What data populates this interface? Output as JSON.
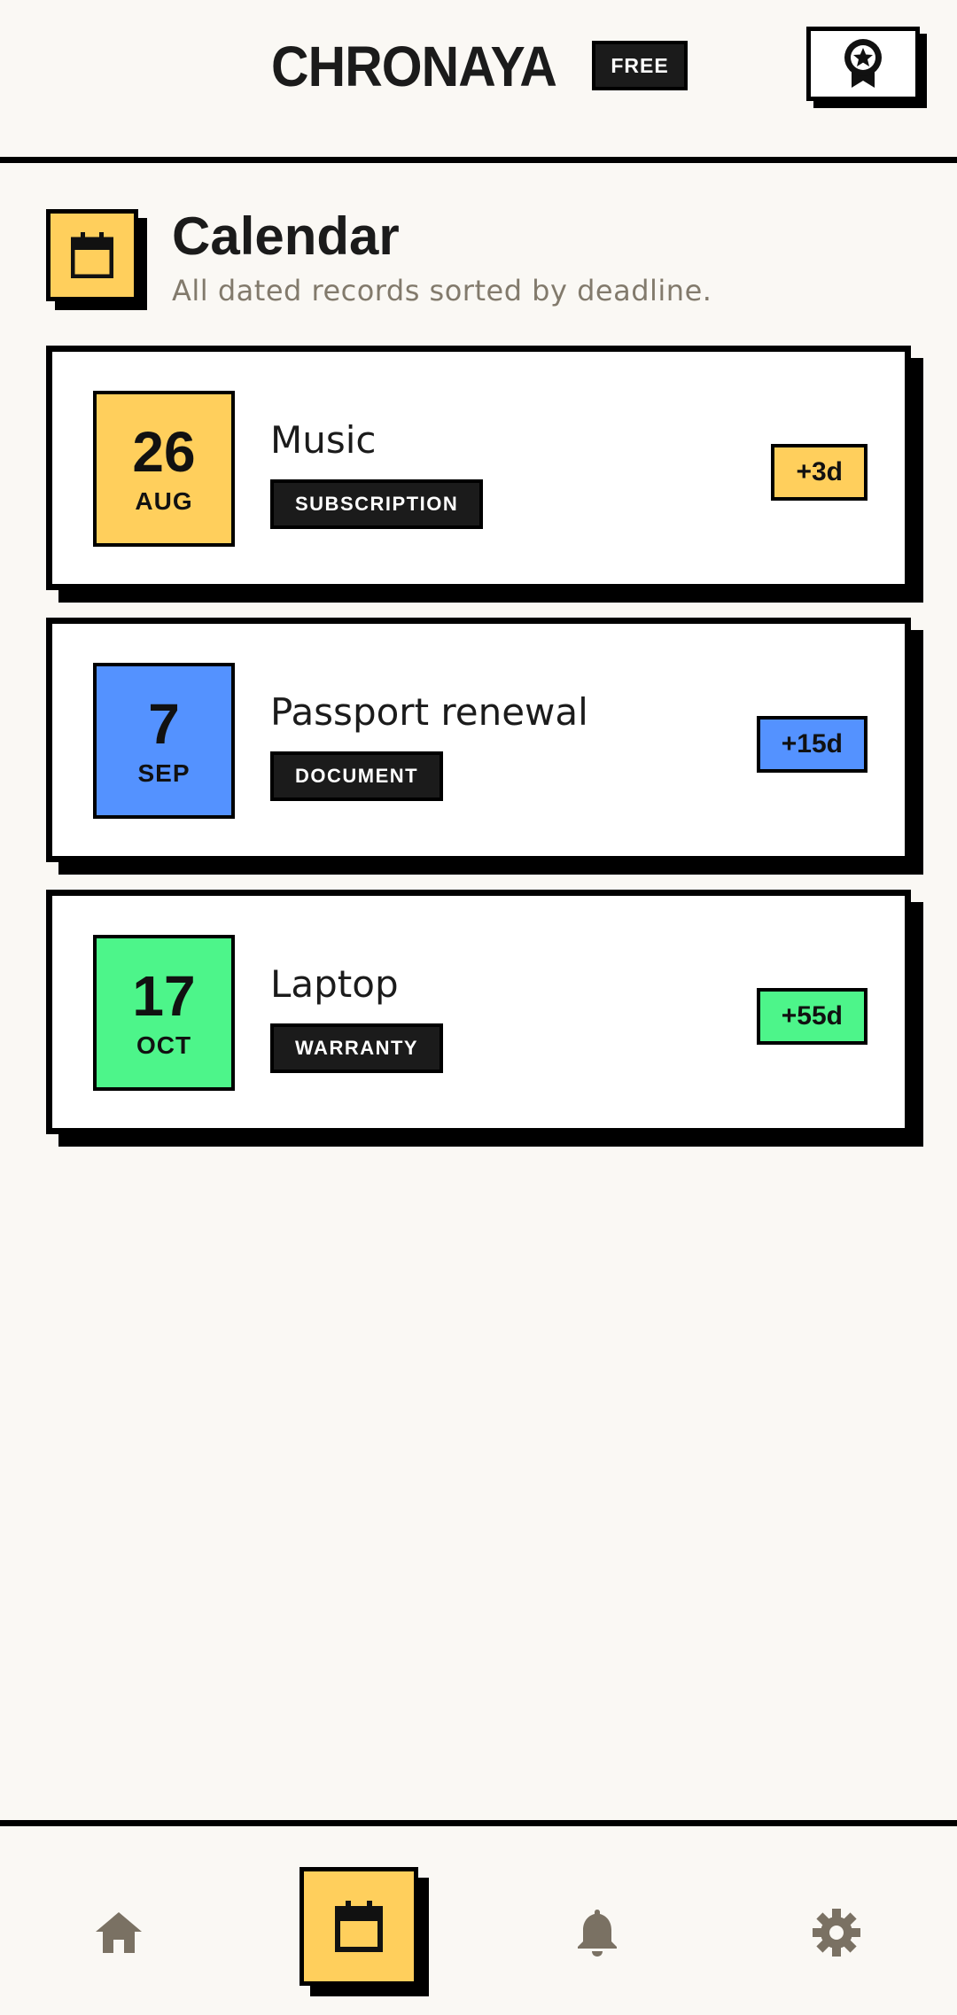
{
  "header": {
    "brand": "CHRONAYA",
    "plan_badge": "FREE",
    "award_icon": "award-ribbon-icon"
  },
  "page": {
    "icon": "calendar-icon",
    "title": "Calendar",
    "subtitle": "All dated records sorted by deadline."
  },
  "records": [
    {
      "day": "26",
      "month": "AUG",
      "name": "Music",
      "category": "SUBSCRIPTION",
      "days_left": "+3d",
      "color": "#ffcf5c"
    },
    {
      "day": "7",
      "month": "SEP",
      "name": "Passport renewal",
      "category": "DOCUMENT",
      "days_left": "+15d",
      "color": "#5492ff"
    },
    {
      "day": "17",
      "month": "OCT",
      "name": "Laptop",
      "category": "WARRANTY",
      "days_left": "+55d",
      "color": "#4df58a"
    }
  ],
  "nav": {
    "items": [
      {
        "icon": "home-icon",
        "active": false
      },
      {
        "icon": "calendar-icon",
        "active": true
      },
      {
        "icon": "bell-icon",
        "active": false
      },
      {
        "icon": "gear-icon",
        "active": false
      }
    ],
    "inactive_color": "#7a7163",
    "active_color": "#ffcf5c"
  },
  "colors": {
    "background": "#faf8f4",
    "accent_yellow": "#ffcf5c",
    "accent_blue": "#5492ff",
    "accent_green": "#4df58a",
    "ink": "#1b1b1b",
    "muted": "#827a6c"
  }
}
